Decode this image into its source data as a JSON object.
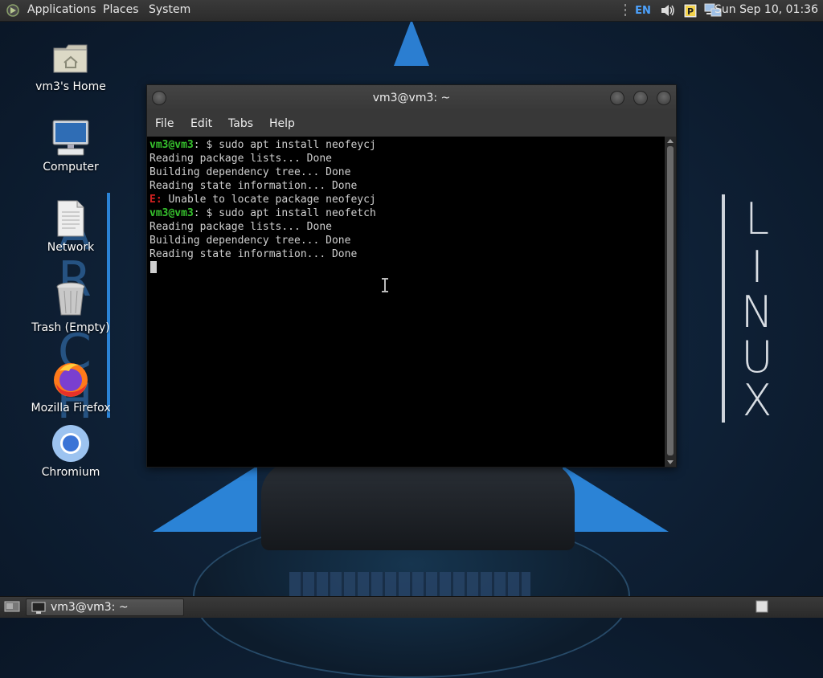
{
  "top_panel": {
    "menus": [
      "Applications",
      "Places",
      "System"
    ],
    "keyboard_layout": "EN",
    "clock": "Sun Sep 10, 01:36"
  },
  "desktop_icons": [
    {
      "label": "vm3's Home",
      "icon": "home-folder-icon"
    },
    {
      "label": "Computer",
      "icon": "computer-icon"
    },
    {
      "label": "Network",
      "icon": "network-icon"
    },
    {
      "label": "Trash (Empty)",
      "icon": "trash-icon"
    },
    {
      "label": "Mozilla Firefox",
      "icon": "firefox-icon"
    },
    {
      "label": "Chromium",
      "icon": "chromium-icon"
    }
  ],
  "wallpaper": {
    "letters_right": [
      "L",
      "I",
      "N",
      "U",
      "X"
    ],
    "letters_left": [
      "A",
      "R",
      "C",
      "H"
    ]
  },
  "terminal": {
    "title": "vm3@vm3: ~",
    "menus": [
      "File",
      "Edit",
      "Tabs",
      "Help"
    ],
    "lines": [
      {
        "prompt": "vm3@vm3",
        "rest": ": $ sudo apt install neofeycj"
      },
      {
        "text": "Reading package lists... Done"
      },
      {
        "text": "Building dependency tree... Done"
      },
      {
        "text": "Reading state information... Done"
      },
      {
        "error_prefix": "E:",
        "rest": " Unable to locate package neofeycj"
      },
      {
        "prompt": "vm3@vm3",
        "rest": ": $ sudo apt install neofetch"
      },
      {
        "text": "Reading package lists... Done"
      },
      {
        "text": "Building dependency tree... Done"
      },
      {
        "text": "Reading state information... Done"
      }
    ]
  },
  "taskbar": {
    "window_label": "vm3@vm3: ~"
  },
  "colors": {
    "prompt": "#36c12d",
    "error": "#d02020",
    "accent_blue": "#2b83d6"
  }
}
